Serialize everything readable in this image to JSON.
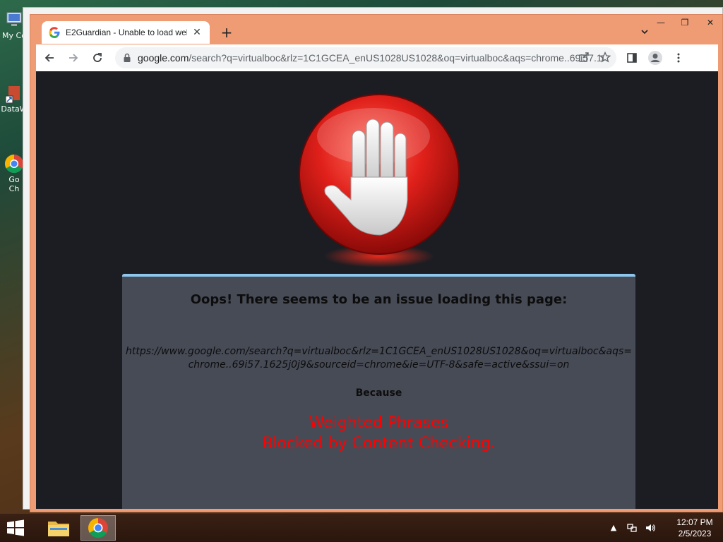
{
  "desktop": {
    "icons": [
      {
        "label": "My Co",
        "icon": "computer-icon"
      },
      {
        "label": "DataW",
        "icon": "shortcut-icon"
      },
      {
        "label": "Go\nCh",
        "icon": "chrome-icon"
      }
    ]
  },
  "browser": {
    "tab": {
      "title": "E2Guardian - Unable to load web"
    },
    "address": {
      "domain": "google.com",
      "path": "/search?q=virtualboc&rlz=1C1GCEA_enUS1028US1028&oq=virtualboc&aqs=chrome..69i57.16..."
    }
  },
  "page": {
    "heading": "Oops! There seems to be an issue loading this page:",
    "blocked_url": "https://www.google.com/search?q=virtualboc&rlz=1C1GCEA_enUS1028US1028&oq=virtualboc&aqs=chrome..69i57.1625j0j9&sourceid=chrome&ie=UTF-8&safe=active&ssui=on",
    "because_label": "Because",
    "reason_line1": "Weighted Phrases",
    "reason_line2": "Blocked by Content Checking."
  },
  "taskbar": {
    "time": "12:07 PM",
    "date": "2/5/2023"
  },
  "colors": {
    "chrome_frame": "#ef9b73",
    "page_bg": "#1c1d22",
    "panel_bg": "#474b56",
    "reason_text": "#ff0000",
    "panel_border": "#8ec7ee"
  }
}
